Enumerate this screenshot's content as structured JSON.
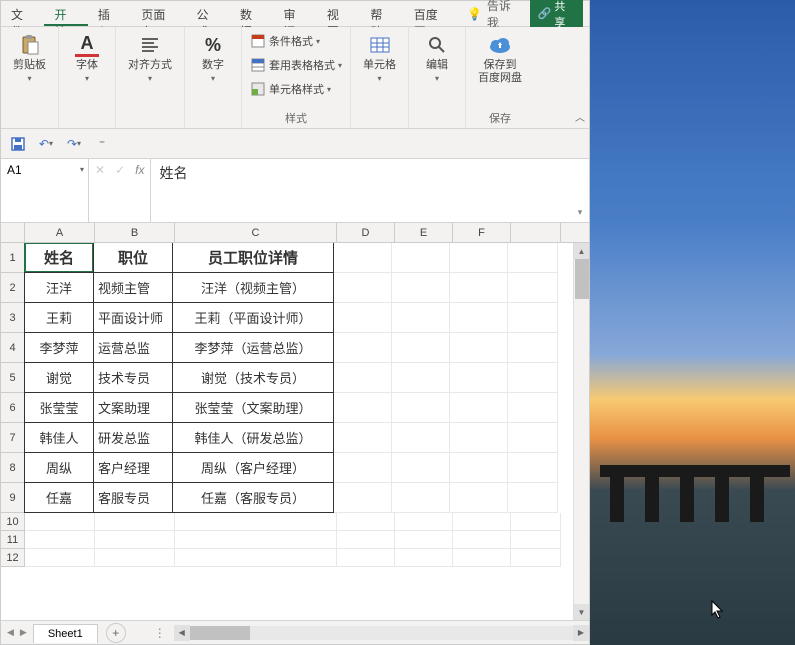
{
  "tabs": {
    "file": "文件",
    "home": "开始",
    "insert": "插入",
    "layout": "页面布",
    "formulas": "公式",
    "data": "数据",
    "review": "审阅",
    "view": "视图",
    "help": "帮助",
    "baidu": "百度网",
    "tellme": "告诉我",
    "share": "共享"
  },
  "ribbon": {
    "clipboard": {
      "label": "剪贴板",
      "btn": "剪贴板"
    },
    "font": {
      "label": "字体",
      "btn": "字体"
    },
    "align": {
      "label": "对齐方式",
      "btn": "对齐方式"
    },
    "number": {
      "label": "数字",
      "btn": "数字"
    },
    "styles": {
      "label": "样式",
      "cond": "条件格式",
      "table": "套用表格格式",
      "cell": "单元格样式"
    },
    "cells": {
      "label": "单元格",
      "btn": "单元格"
    },
    "editing": {
      "label": "编辑",
      "btn": "编辑"
    },
    "save": {
      "label": "保存",
      "btn1": "保存到",
      "btn2": "百度网盘"
    }
  },
  "name_box": "A1",
  "formula": "姓名",
  "columns": [
    "A",
    "B",
    "C",
    "D",
    "E",
    "F"
  ],
  "selected_cell": "A1",
  "table": {
    "headers": [
      "姓名",
      "职位",
      "员工职位详情"
    ],
    "rows": [
      {
        "name": "汪洋",
        "title": "视频主管",
        "detail": "汪洋（视频主管）"
      },
      {
        "name": "王莉",
        "title": "平面设计师",
        "detail": "王莉（平面设计师）"
      },
      {
        "name": "李梦萍",
        "title": "运营总监",
        "detail": "李梦萍（运营总监）"
      },
      {
        "name": "谢觉",
        "title": "技术专员",
        "detail": "谢觉（技术专员）"
      },
      {
        "name": "张莹莹",
        "title": "文案助理",
        "detail": "张莹莹（文案助理）"
      },
      {
        "name": "韩佳人",
        "title": "研发总监",
        "detail": "韩佳人（研发总监）"
      },
      {
        "name": "周纵",
        "title": "客户经理",
        "detail": "周纵（客户经理）"
      },
      {
        "name": "任嘉",
        "title": "客服专员",
        "detail": "任嘉（客服专员）"
      }
    ]
  },
  "sheet_tab": "Sheet1",
  "icons": {
    "paste": "📋",
    "font_a": "A",
    "percent": "%",
    "cells": "▦",
    "search": "🔍",
    "cloud": "☁"
  }
}
